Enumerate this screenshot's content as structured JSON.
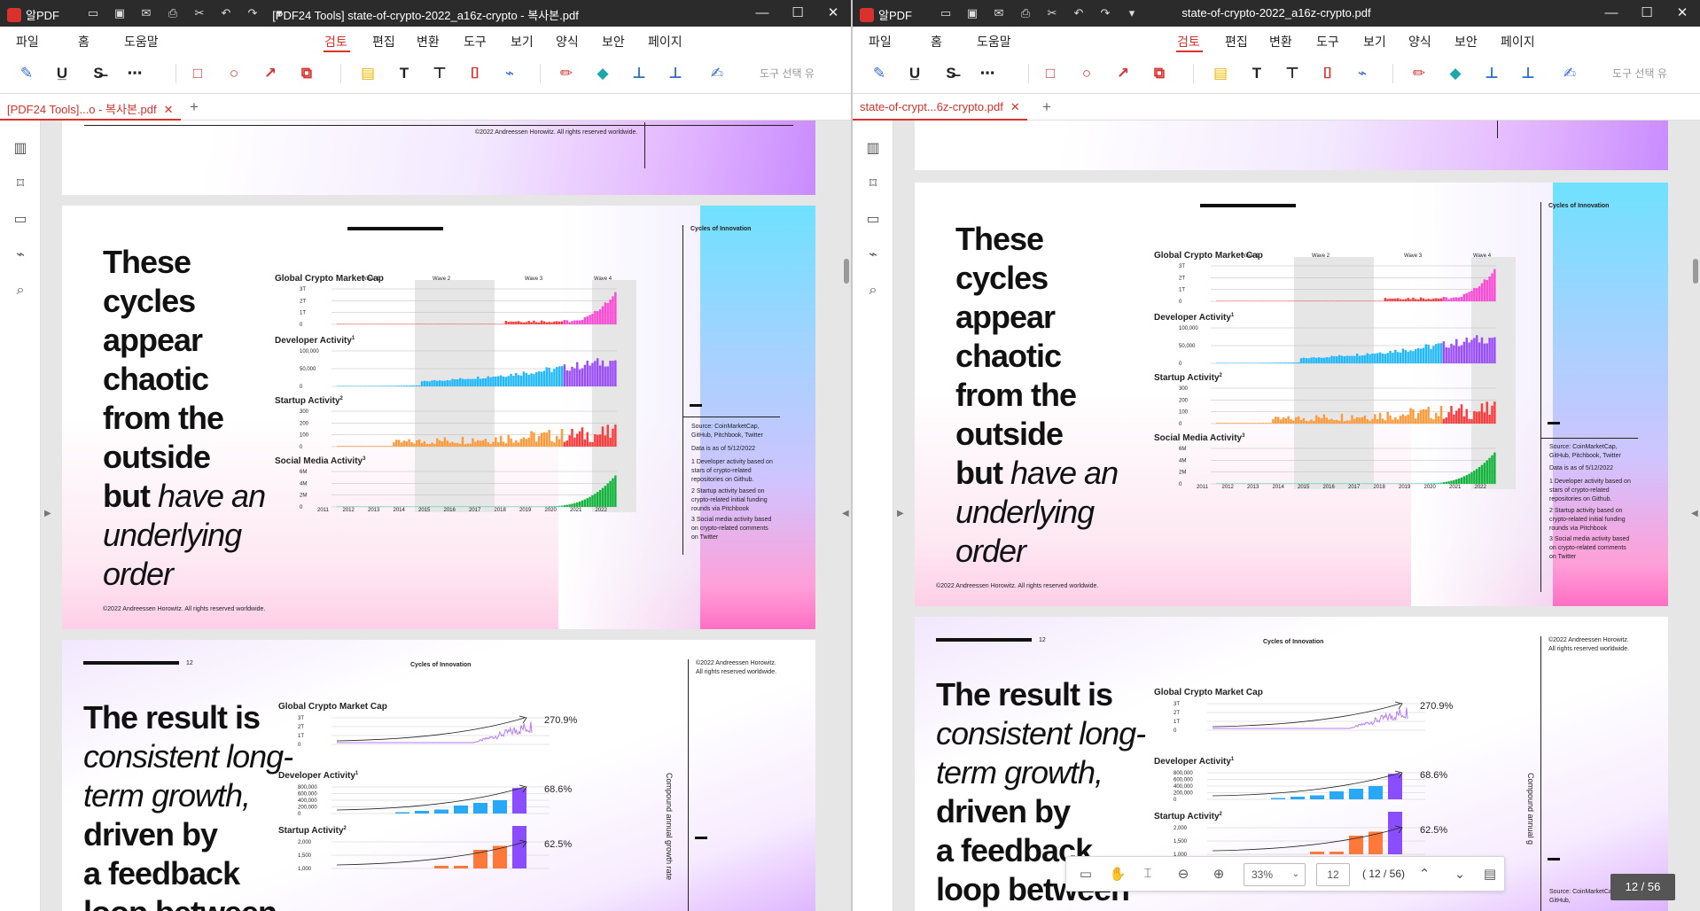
{
  "app": {
    "name": "알PDF"
  },
  "left": {
    "title": "[PDF24 Tools] state-of-crypto-2022_a16z-crypto - 복사본.pdf",
    "tab": "[PDF24 Tools]...o - 복사본.pdf"
  },
  "right": {
    "title": "state-of-crypto-2022_a16z-crypto.pdf",
    "tab": "state-of-crypt...6z-crypto.pdf"
  },
  "menu": [
    "파일",
    "홈",
    "도움말",
    "검토",
    "편집",
    "변환",
    "도구",
    "보기",
    "양식",
    "보안",
    "페이지"
  ],
  "menu_active": "검토",
  "toolbar_hint": "도구 선택 유",
  "doc": {
    "copyright": "©2022 Andreessen Horowitz. All rights reserved worldwide.",
    "copyright_lines": [
      "©2022 Andreessen Horowitz.",
      "All rights reserved worldwide."
    ],
    "section": "Cycles of Innovation",
    "page_num": "12",
    "slide1": {
      "title_bold_lines": [
        "These",
        "cycles",
        "appear",
        "chaotic",
        "from the",
        "outside",
        "but"
      ],
      "title_italic_tail": "have an",
      "title_italic_lines": [
        "underlying",
        "order"
      ],
      "charts": [
        {
          "title": "Global Crypto Market Cap",
          "sup": "",
          "yticks": [
            "3T",
            "2T",
            "1T",
            "0"
          ]
        },
        {
          "title": "Developer Activity",
          "sup": "1",
          "yticks": [
            "100,000",
            "50,000",
            "0"
          ]
        },
        {
          "title": "Startup Activity",
          "sup": "2",
          "yticks": [
            "300",
            "200",
            "100",
            "0"
          ]
        },
        {
          "title": "Social Media Activity",
          "sup": "3",
          "yticks": [
            "6M",
            "4M",
            "2M",
            "0"
          ]
        }
      ],
      "waves": [
        "Wave 1",
        "Wave 2",
        "Wave 3",
        "Wave 4"
      ],
      "years": [
        "2011",
        "2012",
        "2013",
        "2014",
        "2015",
        "2016",
        "2017",
        "2018",
        "2019",
        "2020",
        "2021",
        "2022"
      ],
      "source": "Source: CoinMarketCap, GitHub, Pitchbook, Twitter",
      "date": "Data is as of 5/12/2022",
      "notes": [
        "1 Developer activity based on stars of crypto-related repositories on Github.",
        "2 Startup activity based on crypto-related initial funding rounds via Pitchbook",
        "3 Social media activity based on crypto-related comments on Twitter"
      ]
    },
    "slide2": {
      "title_line1": "The result is",
      "title_italic": [
        "consistent long-",
        "term growth,"
      ],
      "title_bold": [
        "driven by",
        "a feedback",
        "loop between"
      ],
      "charts": [
        {
          "title": "Global Crypto Market Cap",
          "sup": "",
          "pct": "270.9%",
          "yticks": [
            "3T",
            "2T",
            "1T",
            "0"
          ]
        },
        {
          "title": "Developer Activity",
          "sup": "1",
          "pct": "68.6%",
          "yticks": [
            "800,000",
            "600,000",
            "400,000",
            "200,000",
            "0"
          ]
        },
        {
          "title": "Startup Activity",
          "sup": "2",
          "pct": "62.5%",
          "yticks": [
            "2,000",
            "1,500",
            "1,000"
          ]
        }
      ],
      "vertical_label_left": "Compound annual growth rate",
      "vertical_label_right": "Compound annual g",
      "source_partial": "Source: CoinMarketCap, GitHub,"
    }
  },
  "nav": {
    "zoom": "33%",
    "page_input": "12",
    "page_count": "( 12 / 56)",
    "badge": "12 / 56"
  }
}
